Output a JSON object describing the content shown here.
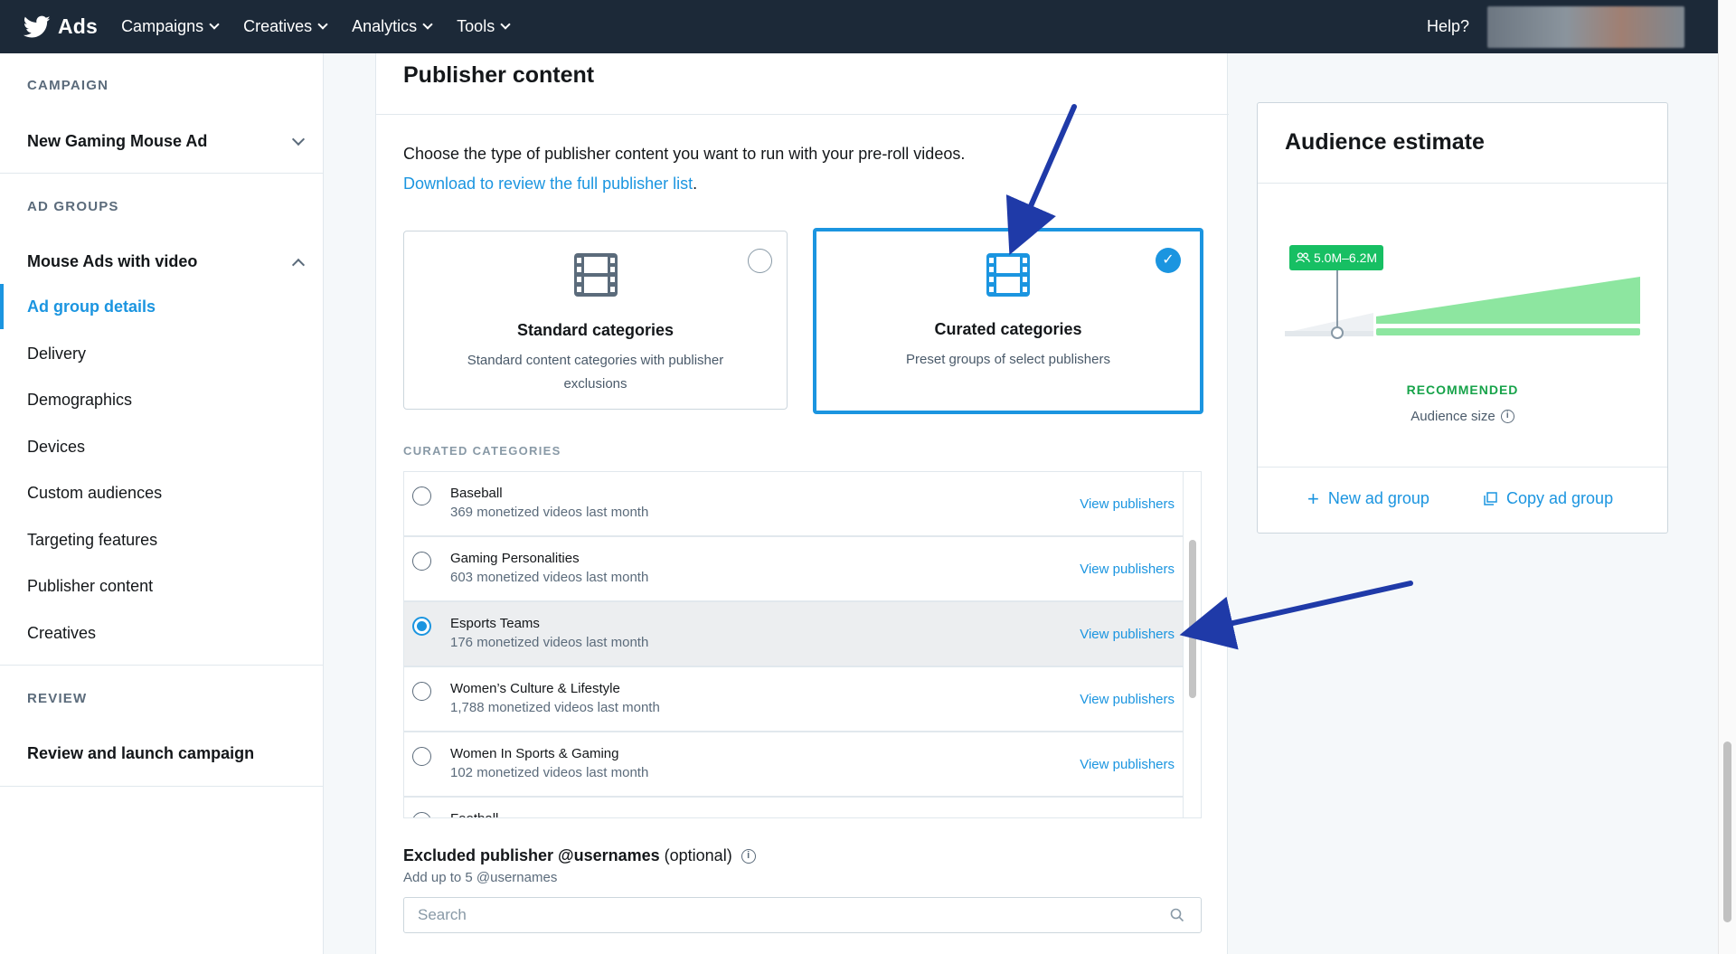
{
  "topbar": {
    "brand": "Ads",
    "menu": [
      "Campaigns",
      "Creatives",
      "Analytics",
      "Tools"
    ],
    "help": "Help?"
  },
  "sidebar": {
    "campaign_section": "CAMPAIGN",
    "campaign_name": "New Gaming Mouse Ad",
    "adgroups_section": "AD GROUPS",
    "adgroup_name": "Mouse Ads with video",
    "items": [
      {
        "label": "Ad group details",
        "active": true
      },
      {
        "label": "Delivery"
      },
      {
        "label": "Demographics"
      },
      {
        "label": "Devices"
      },
      {
        "label": "Custom audiences"
      },
      {
        "label": "Targeting features"
      },
      {
        "label": "Publisher content"
      },
      {
        "label": "Creatives"
      }
    ],
    "review_section": "REVIEW",
    "review_link": "Review and launch campaign"
  },
  "main": {
    "title": "Publisher content",
    "intro": "Choose the type of publisher content you want to run with your pre-roll videos.",
    "download_link": "Download to review the full publisher list",
    "download_suffix": ".",
    "options": [
      {
        "title": "Standard categories",
        "desc": "Standard content categories with publisher exclusions",
        "selected": false
      },
      {
        "title": "Curated categories",
        "desc": "Preset groups of select publishers",
        "selected": true
      }
    ],
    "curated_label": "CURATED CATEGORIES",
    "rows": [
      {
        "name": "Baseball",
        "sub": "369 monetized videos last month",
        "link": "View publishers",
        "selected": false
      },
      {
        "name": "Gaming Personalities",
        "sub": "603 monetized videos last month",
        "link": "View publishers",
        "selected": false
      },
      {
        "name": "Esports Teams",
        "sub": "176 monetized videos last month",
        "link": "View publishers",
        "selected": true
      },
      {
        "name": "Women’s Culture & Lifestyle",
        "sub": "1,788 monetized videos last month",
        "link": "View publishers",
        "selected": false
      },
      {
        "name": "Women In Sports & Gaming",
        "sub": "102 monetized videos last month",
        "link": "View publishers",
        "selected": false
      },
      {
        "name": "Football",
        "sub": "",
        "link": "",
        "selected": false
      }
    ],
    "excluded": {
      "title": "Excluded publisher @usernames",
      "optional": "(optional)",
      "hint": "Add up to 5 @usernames",
      "placeholder": "Search"
    }
  },
  "audience": {
    "title": "Audience estimate",
    "range": "5.0M–6.2M",
    "recommended": "RECOMMENDED",
    "size_label": "Audience size",
    "new_ad_group": "New ad group",
    "copy_ad_group": "Copy ad group"
  },
  "colors": {
    "nav_bg": "#1c2938",
    "accent": "#1b95e0",
    "recommended_green": "#17bf63",
    "chart_fill": "#8de6a0",
    "annotation_arrow": "#1f3aa8"
  }
}
